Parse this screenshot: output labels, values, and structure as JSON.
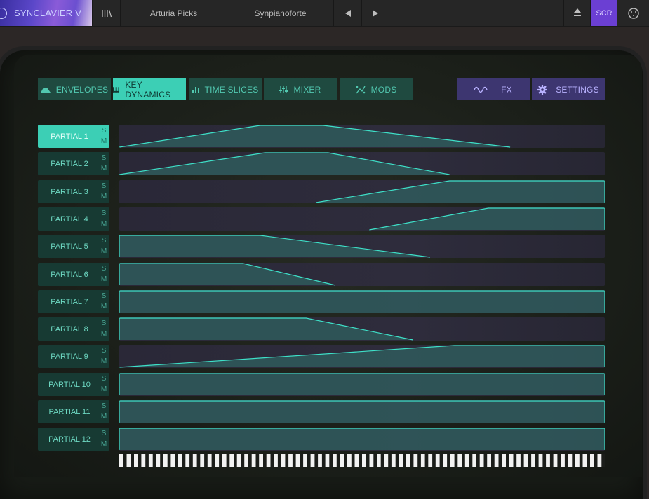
{
  "topbar": {
    "app_title": "SYNCLAVIER V",
    "bank": "Arturia Picks",
    "preset": "Synpianoforte",
    "scr_label": "SCR"
  },
  "tabs": [
    {
      "label": "ENVELOPES",
      "icon": "envelope-icon",
      "active": false
    },
    {
      "label": "KEY DYNAMICS",
      "icon": "keyboard-icon",
      "active": true
    },
    {
      "label": "TIME SLICES",
      "icon": "bars-icon",
      "active": false
    },
    {
      "label": "MIXER",
      "icon": "sliders-icon",
      "active": false
    },
    {
      "label": "MODS",
      "icon": "mods-icon",
      "active": false
    },
    {
      "label": "FX",
      "icon": "wave-icon",
      "active": false
    },
    {
      "label": "SETTINGS",
      "icon": "gear-icon",
      "active": false
    }
  ],
  "solo_label": "S",
  "mute_label": "M",
  "partials": [
    {
      "label": "PARTIAL 1",
      "active": true,
      "curve": [
        [
          0,
          1
        ],
        [
          0.29,
          0
        ],
        [
          0.42,
          0
        ],
        [
          0.805,
          1
        ]
      ]
    },
    {
      "label": "PARTIAL 2",
      "active": false,
      "curve": [
        [
          0,
          1
        ],
        [
          0.3,
          0
        ],
        [
          0.43,
          0
        ],
        [
          0.68,
          1
        ]
      ]
    },
    {
      "label": "PARTIAL 3",
      "active": false,
      "curve": [
        [
          0.405,
          1
        ],
        [
          0.68,
          0
        ],
        [
          1,
          0
        ],
        [
          1,
          1
        ]
      ]
    },
    {
      "label": "PARTIAL 4",
      "active": false,
      "curve": [
        [
          0.515,
          1
        ],
        [
          0.76,
          0
        ],
        [
          1,
          0
        ],
        [
          1,
          1
        ]
      ]
    },
    {
      "label": "PARTIAL 5",
      "active": false,
      "curve": [
        [
          0,
          1
        ],
        [
          0,
          0
        ],
        [
          0.29,
          0
        ],
        [
          0.64,
          1
        ]
      ]
    },
    {
      "label": "PARTIAL 6",
      "active": false,
      "curve": [
        [
          0,
          1
        ],
        [
          0,
          0
        ],
        [
          0.255,
          0
        ],
        [
          0.445,
          1
        ]
      ]
    },
    {
      "label": "PARTIAL 7",
      "active": false,
      "curve": [
        [
          0,
          1
        ],
        [
          0,
          0
        ],
        [
          1,
          0
        ],
        [
          1,
          1
        ]
      ]
    },
    {
      "label": "PARTIAL 8",
      "active": false,
      "curve": [
        [
          0,
          1
        ],
        [
          0,
          0
        ],
        [
          0.385,
          0
        ],
        [
          0.605,
          1
        ]
      ]
    },
    {
      "label": "PARTIAL 9",
      "active": false,
      "curve": [
        [
          0,
          1
        ],
        [
          0.69,
          0
        ],
        [
          1,
          0
        ],
        [
          1,
          1
        ]
      ]
    },
    {
      "label": "PARTIAL 10",
      "active": false,
      "curve": [
        [
          0,
          1
        ],
        [
          0,
          0
        ],
        [
          1,
          0
        ],
        [
          1,
          1
        ]
      ]
    },
    {
      "label": "PARTIAL 11",
      "active": false,
      "curve": [
        [
          0,
          1
        ],
        [
          0,
          0
        ],
        [
          1,
          0
        ],
        [
          1,
          1
        ]
      ]
    },
    {
      "label": "PARTIAL 12",
      "active": false,
      "curve": [
        [
          0,
          1
        ],
        [
          0,
          0
        ],
        [
          1,
          0
        ],
        [
          1,
          1
        ]
      ]
    }
  ],
  "colors": {
    "accent": "#3ccfb5",
    "curve_line": "#3ee0c8",
    "curve_fill": "#2f5a5c",
    "purple": "#6b3fd3"
  }
}
